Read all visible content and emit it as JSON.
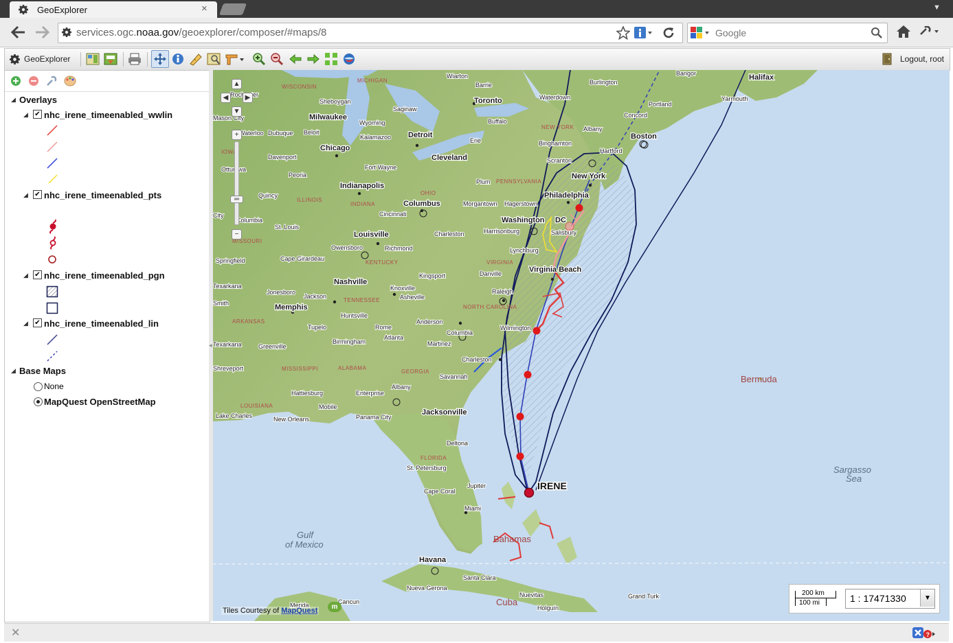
{
  "browser": {
    "tab_title": "GeoExplorer",
    "close_glyph": "×",
    "url_prefix": "services.ogc.",
    "url_host": "noaa.gov",
    "url_path": "/geoexplorer/composer/#maps/8",
    "search_engine": "Google"
  },
  "app": {
    "title": "GeoExplorer",
    "logout_label": "Logout, root"
  },
  "tree": {
    "overlays_label": "Overlays",
    "layers": [
      {
        "name": "nhc_irene_timeenabled_wwlin"
      },
      {
        "name": "nhc_irene_timeenabled_pts"
      },
      {
        "name": "nhc_irene_timeenabled_pgn"
      },
      {
        "name": "nhc_irene_timeenabled_lin"
      }
    ],
    "basemaps_label": "Base Maps",
    "basemaps": [
      {
        "name": "None",
        "selected": false
      },
      {
        "name": "MapQuest OpenStreetMap",
        "selected": true
      }
    ]
  },
  "map": {
    "storm_label": "IRENE",
    "scale_km": "200 km",
    "scale_mi": "100 mi",
    "scale_value": "1 : 17471330",
    "attribution_prefix": "Tiles Courtesy of ",
    "attribution_link": "MapQuest",
    "places": {
      "wisconsin": "WISCONSIN",
      "michigan": "MICHIGAN",
      "rochester": "Rochester",
      "sheboygan": "Sheboygan",
      "milwaukee": "Milwaukee",
      "toronto": "Toronto",
      "barrie": "Barrie",
      "wiarton": "Wiarton",
      "waterdown": "Waterdown",
      "burlington": "Burlington",
      "bangor": "Bangor",
      "halifax": "Halifax",
      "yarmouth": "Yarmouth",
      "portland": "Portland",
      "concord": "Concord",
      "boston": "Boston",
      "albany": "Albany",
      "newyork_state": "NEW YORK",
      "buffalo": "Buffalo",
      "saginaw": "Saginaw",
      "wyoming": "Wyoming",
      "kalamazoo": "Kalamazoo",
      "detroit": "Detroit",
      "erie": "Erie",
      "binghamton": "Binghamton",
      "hartford": "Hartford",
      "scranton": "Scranton",
      "masoncity": "Mason City",
      "waterloo": "Waterloo",
      "dubuque": "Dubuque",
      "beloit": "Beloit",
      "chicago": "Chicago",
      "cleveland": "Cleveland",
      "iowa": "IOWA",
      "davenport": "Davenport",
      "ottumwa": "Ottumwa",
      "peoria": "Peoria",
      "fortwayne": "Fort Wayne",
      "pennsylvania": "PENNSYLVANIA",
      "plum": "Plum",
      "newyork": "New York",
      "philadelphia": "Philadelphia",
      "quincy": "Quincy",
      "illinois": "ILLINOIS",
      "indianapolis": "Indianapolis",
      "indiana": "INDIANA",
      "ohio": "OHIO",
      "columbus": "Columbus",
      "morgantown": "Morgantown",
      "hagerstown": "Hagerstown",
      "washington": "Washington",
      "dc": "DC",
      "salisbury": "Salisbury",
      "kscity": "City",
      "columbia": "Columbia",
      "stlouis": "St. Louis",
      "cincinnati": "Cincinnati",
      "missouri": "MISSOURI",
      "louisville": "Louisville",
      "charleston_wv": "Charleston",
      "harrisonburg": "Harrisonburg",
      "springfield": "Springfield",
      "capegirardeau": "Cape Girardeau",
      "owensboro": "Owensboro",
      "richmond": "Richmond",
      "kentucky": "KENTUCKY",
      "virginia": "VIRGINIA",
      "lynchburg": "Lynchburg",
      "virginiabeach": "Virginia Beach",
      "kingsport": "Kingsport",
      "danville": "Danville",
      "nashville": "Nashville",
      "knoxville": "Knoxville",
      "jonesboro": "Jonesboro",
      "jackson": "Jackson",
      "tennessee": "TENNESSEE",
      "asheville": "Asheville",
      "raleigh": "Raleigh",
      "memphis": "Memphis",
      "northcarolina": "NORTH CAROLINA",
      "arkansas": "ARKANSAS",
      "huntsville": "Huntsville",
      "anderson": "Anderson",
      "rome": "Rome",
      "tupelo": "Tupelo",
      "wilmington": "Wilmington",
      "birmingham": "Birmingham",
      "atlanta": "Atlanta",
      "martinez": "Martinez",
      "columbia_sc": "Columbia",
      "greenville": "Greenville",
      "charleston": "Charleston",
      "mississippi": "MISSISSIPPI",
      "alabama": "ALABAMA",
      "georgia": "GEORGIA",
      "savannah": "Savannah",
      "shreveport": "Shreveport",
      "texarkana": "Texarkana",
      "albany_ga": "Albany",
      "hattiesburg": "Hattiesburg",
      "enterprise": "Enterprise",
      "louisiana": "LOUISIANA",
      "mobile": "Mobile",
      "lakecharles": "Lake Charles",
      "neworleans": "New Orleans",
      "panamacity": "Panama City",
      "jacksonville": "Jacksonville",
      "deltona": "Deltona",
      "florida": "FLORIDA",
      "stpetersburg": "St. Petersburg",
      "capecoral": "Cape Coral",
      "jupiter": "Jupiter",
      "miami": "Miami",
      "gulf1": "Gulf",
      "gulf2": "of Mexico",
      "bahamas": "Bahamas",
      "havana": "Havana",
      "santaclara": "Santa Clara",
      "nuevagerona": "Nueva Gerona",
      "cuba": "Cuba",
      "nuevitas": "Nuevitas",
      "holguin": "Holguín",
      "grandturk": "Grand Turk",
      "merida": "Merida",
      "cancun": "Cancun",
      "bermuda": "Bermuda",
      "sargasso1": "Sargasso",
      "sargasso2": "Sea",
      "smith": "Smith"
    }
  }
}
